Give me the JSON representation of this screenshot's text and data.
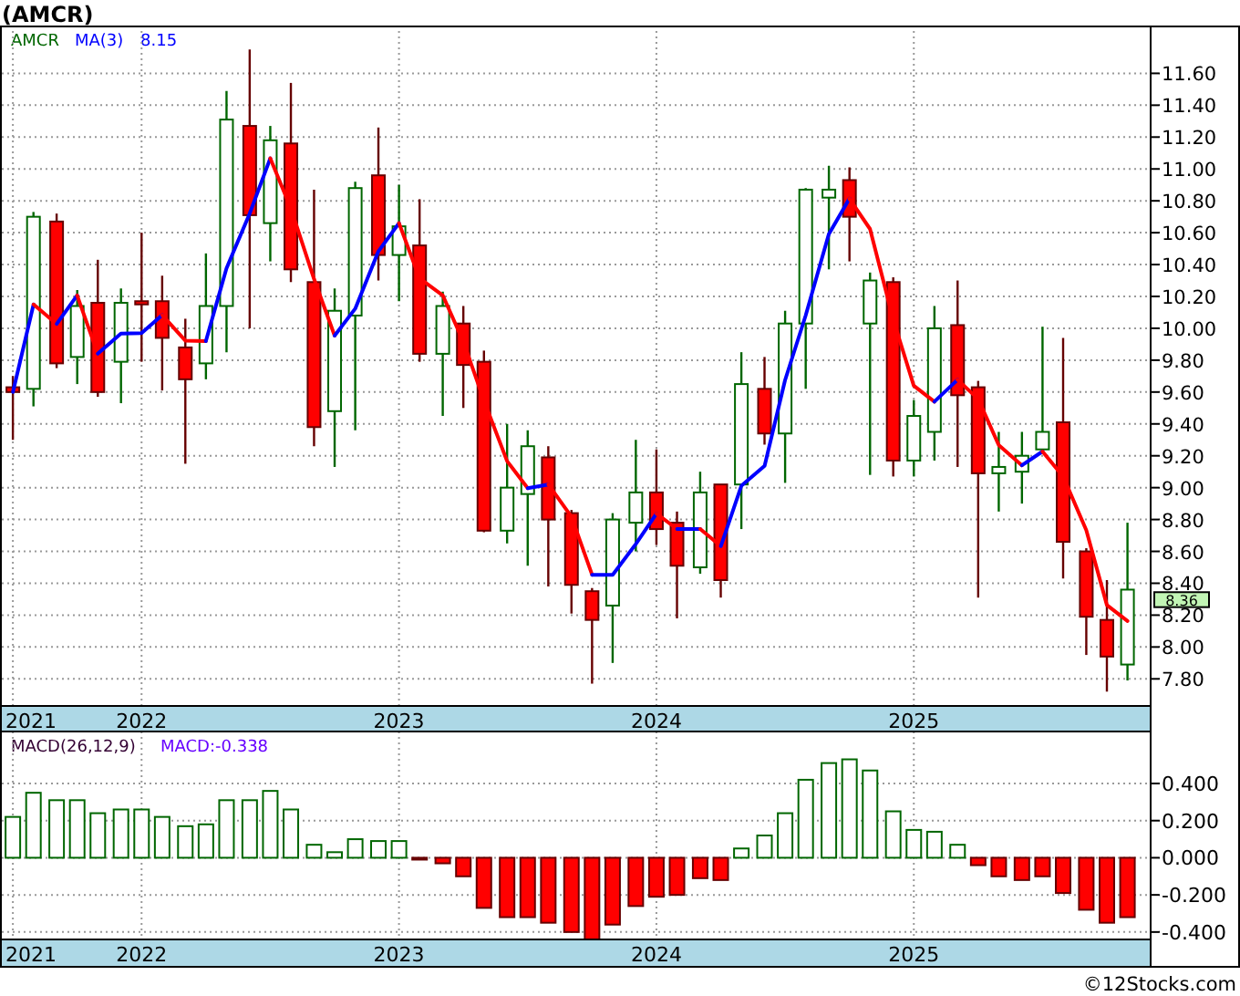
{
  "title": "(AMCR)",
  "price_panel": {
    "symbol_label": "AMCR",
    "ma_label": "MA(3)",
    "ma_value": "8.15",
    "last_price": "8.36",
    "axis_start_label": "2021",
    "chart_data": {
      "type": "candlestick",
      "grid": true,
      "ylim": [
        7.63,
        11.9
      ],
      "xlim": [
        2021.45,
        2025.92
      ],
      "x": [
        2021.5,
        2021.58,
        2021.67,
        2021.75,
        2021.83,
        2021.92,
        2022,
        2022.08,
        2022.17,
        2022.25,
        2022.33,
        2022.42,
        2022.5,
        2022.58,
        2022.67,
        2022.75,
        2022.83,
        2022.92,
        2023,
        2023.08,
        2023.17,
        2023.25,
        2023.33,
        2023.42,
        2023.5,
        2023.58,
        2023.67,
        2023.75,
        2023.83,
        2023.92,
        2024,
        2024.08,
        2024.17,
        2024.25,
        2024.33,
        2024.42,
        2024.5,
        2024.58,
        2024.67,
        2024.75,
        2024.83,
        2024.92,
        2025,
        2025.08,
        2025.17,
        2025.25,
        2025.33,
        2025.42,
        2025.5,
        2025.58,
        2025.67,
        2025.75,
        2025.83
      ],
      "yticks": [
        {
          "value": 7.8,
          "label": "7.80"
        },
        {
          "value": 8.0,
          "label": "8.00"
        },
        {
          "value": 8.2,
          "label": "8.20"
        },
        {
          "value": 8.4,
          "label": "8.40"
        },
        {
          "value": 8.6,
          "label": "8.60"
        },
        {
          "value": 8.8,
          "label": "8.80"
        },
        {
          "value": 9.0,
          "label": "9.00"
        },
        {
          "value": 9.2,
          "label": "9.20"
        },
        {
          "value": 9.4,
          "label": "9.40"
        },
        {
          "value": 9.6,
          "label": "9.60"
        },
        {
          "value": 9.8,
          "label": "9.80"
        },
        {
          "value": 10.0,
          "label": "10.00"
        },
        {
          "value": 10.2,
          "label": "10.20"
        },
        {
          "value": 10.4,
          "label": "10.40"
        },
        {
          "value": 10.6,
          "label": "10.60"
        },
        {
          "value": 10.8,
          "label": "10.80"
        },
        {
          "value": 11.0,
          "label": "11.00"
        },
        {
          "value": 11.2,
          "label": "11.20"
        },
        {
          "value": 11.4,
          "label": "11.40"
        },
        {
          "value": 11.6,
          "label": "11.60"
        }
      ],
      "xticks": [
        {
          "value": 2022,
          "label": "2022"
        },
        {
          "value": 2023,
          "label": "2023"
        },
        {
          "value": 2024,
          "label": "2024"
        },
        {
          "value": 2025,
          "label": "2025"
        }
      ],
      "ohlc": [
        [
          9.63,
          9.7,
          9.3,
          9.6
        ],
        [
          9.62,
          10.73,
          9.51,
          10.7
        ],
        [
          10.67,
          10.72,
          9.75,
          9.78
        ],
        [
          9.82,
          10.24,
          9.65,
          10.14
        ],
        [
          10.16,
          10.43,
          9.57,
          9.6
        ],
        [
          9.79,
          10.25,
          9.53,
          10.16
        ],
        [
          10.17,
          10.6,
          9.79,
          10.15
        ],
        [
          10.17,
          10.33,
          9.61,
          9.94
        ],
        [
          9.88,
          10.06,
          9.15,
          9.68
        ],
        [
          9.78,
          10.47,
          9.68,
          10.14
        ],
        [
          10.14,
          11.49,
          9.85,
          11.31
        ],
        [
          11.27,
          11.75,
          10.0,
          10.71
        ],
        [
          10.66,
          11.27,
          10.42,
          11.18
        ],
        [
          11.16,
          11.54,
          10.29,
          10.37
        ],
        [
          10.29,
          10.87,
          9.26,
          9.38
        ],
        [
          9.48,
          10.25,
          9.13,
          10.11
        ],
        [
          10.08,
          10.92,
          9.36,
          10.88
        ],
        [
          10.96,
          11.26,
          10.3,
          10.46
        ],
        [
          10.46,
          10.9,
          10.17,
          10.64
        ],
        [
          10.52,
          10.81,
          9.79,
          9.84
        ],
        [
          9.84,
          10.23,
          9.45,
          10.14
        ],
        [
          10.03,
          10.14,
          9.5,
          9.77
        ],
        [
          9.79,
          9.86,
          8.72,
          8.73
        ],
        [
          8.73,
          9.4,
          8.65,
          9.0
        ],
        [
          8.96,
          9.36,
          8.51,
          9.26
        ],
        [
          9.19,
          9.26,
          8.38,
          8.8
        ],
        [
          8.84,
          8.86,
          8.21,
          8.39
        ],
        [
          8.35,
          8.37,
          7.77,
          8.17
        ],
        [
          8.26,
          8.84,
          7.9,
          8.8
        ],
        [
          8.78,
          9.3,
          8.6,
          8.97
        ],
        [
          8.97,
          9.24,
          8.64,
          8.74
        ],
        [
          8.78,
          8.85,
          8.18,
          8.51
        ],
        [
          8.5,
          9.1,
          8.46,
          8.97
        ],
        [
          9.02,
          9.02,
          8.31,
          8.42
        ],
        [
          9.02,
          9.85,
          8.74,
          9.65
        ],
        [
          9.62,
          9.82,
          9.27,
          9.34
        ],
        [
          9.34,
          10.11,
          9.03,
          10.03
        ],
        [
          10.03,
          10.88,
          9.62,
          10.87
        ],
        [
          10.82,
          11.02,
          10.37,
          10.87
        ],
        [
          10.93,
          11.01,
          10.42,
          10.7
        ],
        [
          10.03,
          10.35,
          9.08,
          10.3
        ],
        [
          10.29,
          10.32,
          9.07,
          9.17
        ],
        [
          9.17,
          9.55,
          9.07,
          9.45
        ],
        [
          9.35,
          10.14,
          9.17,
          10.0
        ],
        [
          10.02,
          10.3,
          9.13,
          9.58
        ],
        [
          9.63,
          9.67,
          8.31,
          9.09
        ],
        [
          9.09,
          9.35,
          8.85,
          9.13
        ],
        [
          9.1,
          9.35,
          8.9,
          9.2
        ],
        [
          9.24,
          10.01,
          9.22,
          9.35
        ],
        [
          9.41,
          9.94,
          8.43,
          8.66
        ],
        [
          8.6,
          8.62,
          7.95,
          8.19
        ],
        [
          8.17,
          8.42,
          7.72,
          7.94
        ],
        [
          7.89,
          8.78,
          7.79,
          8.36
        ]
      ]
    }
  },
  "macd_panel": {
    "label": "MACD(26,12,9)",
    "value": "MACD:-0.338",
    "axis_start_label": "2021",
    "chart_data": {
      "type": "bar",
      "grid": true,
      "ylim": [
        -0.44,
        0.68
      ],
      "xlim": [
        2021.45,
        2025.92
      ],
      "x": [
        2021.5,
        2021.58,
        2021.67,
        2021.75,
        2021.83,
        2021.92,
        2022,
        2022.08,
        2022.17,
        2022.25,
        2022.33,
        2022.42,
        2022.5,
        2022.58,
        2022.67,
        2022.75,
        2022.83,
        2022.92,
        2023,
        2023.08,
        2023.17,
        2023.25,
        2023.33,
        2023.42,
        2023.5,
        2023.58,
        2023.67,
        2023.75,
        2023.83,
        2023.92,
        2024,
        2024.08,
        2024.17,
        2024.25,
        2024.33,
        2024.42,
        2024.5,
        2024.58,
        2024.67,
        2024.75,
        2024.83,
        2024.92,
        2025,
        2025.08,
        2025.17,
        2025.25,
        2025.33,
        2025.42,
        2025.5,
        2025.58,
        2025.67,
        2025.75,
        2025.83
      ],
      "yticks": [
        {
          "value": -0.4,
          "label": "-0.400"
        },
        {
          "value": -0.2,
          "label": "-0.200"
        },
        {
          "value": 0,
          "label": "0.000"
        },
        {
          "value": 0.2,
          "label": "0.200"
        },
        {
          "value": 0.4,
          "label": "0.400"
        }
      ],
      "xticks": [
        {
          "value": 2022,
          "label": "2022"
        },
        {
          "value": 2023,
          "label": "2023"
        },
        {
          "value": 2024,
          "label": "2024"
        },
        {
          "value": 2025,
          "label": "2025"
        }
      ],
      "values": [
        0.22,
        0.35,
        0.31,
        0.31,
        0.24,
        0.26,
        0.26,
        0.22,
        0.17,
        0.18,
        0.31,
        0.31,
        0.36,
        0.26,
        0.07,
        0.03,
        0.1,
        0.09,
        0.09,
        -0.01,
        -0.03,
        -0.1,
        -0.27,
        -0.32,
        -0.32,
        -0.35,
        -0.4,
        -0.44,
        -0.36,
        -0.26,
        -0.21,
        -0.2,
        -0.11,
        -0.12,
        0.05,
        0.12,
        0.24,
        0.42,
        0.51,
        0.53,
        0.47,
        0.25,
        0.15,
        0.14,
        0.07,
        -0.04,
        -0.1,
        -0.12,
        -0.1,
        -0.19,
        -0.28,
        -0.35,
        -0.32
      ]
    }
  },
  "copyright": "©12Stocks.com"
}
